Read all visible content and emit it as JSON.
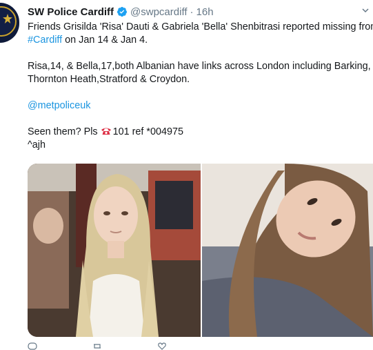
{
  "account": {
    "name": "SW Police Cardiff",
    "handle": "@swpcardiff",
    "separator": "·",
    "time": "16h",
    "avatar_icon": "police-badge-icon",
    "verified_icon": "verified-badge-icon"
  },
  "tweet": {
    "line1": "Friends Grisilda 'Risa' Dauti & Gabriela 'Bella' Shenbitrasi reported missing from",
    "hashtag": "#Cardiff",
    "line2_rest": " on Jan 14 & Jan 4.",
    "line3": "Risa,14, & Bella,17,both Albanian have links across London including Barking,",
    "line4": "Thornton Heath,Stratford & Croydon.",
    "mention": "@metpoliceuk",
    "seen_prefix": "Seen them? Pls ",
    "phone_icon": "telephone-icon",
    "seen_rest": "101 ref *004975",
    "signature": "^ajh"
  },
  "media": {
    "photos": [
      {
        "name": "missing-person-photo-1"
      },
      {
        "name": "missing-person-photo-2"
      }
    ]
  },
  "colors": {
    "link": "#1b95e0",
    "verified": "#1da1f2",
    "muted": "#657786",
    "text": "#14171a"
  }
}
